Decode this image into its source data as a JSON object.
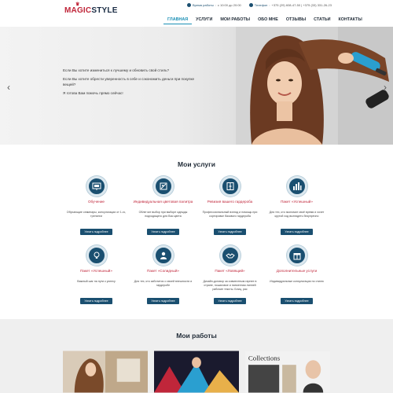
{
  "header": {
    "logo_magic": "MAGIC",
    "logo_style": "STYLE",
    "hours_label": "Время работы",
    "hours_value": "с 10:00 до 20:00",
    "phone_label": "Телефон",
    "phone_value": "+375 (29) 608-47-50 | +375 (33) 331-26-23",
    "nav": [
      {
        "label": "Главная",
        "active": true
      },
      {
        "label": "Услуги"
      },
      {
        "label": "Мои работы"
      },
      {
        "label": "Обо мне"
      },
      {
        "label": "Отзывы"
      },
      {
        "label": "Статьи"
      },
      {
        "label": "Контакты"
      }
    ]
  },
  "hero": {
    "lines": [
      "Если Вы хотите измениться к лучшему и обновить свой стиль?",
      "Если Вы хотите обрести уверенность в себе и сэкономить деньги при покупке вещей?",
      "Я готова Вам помочь прямо сейчас!"
    ],
    "prev": "‹",
    "next": "›"
  },
  "services": {
    "title": "Мои услуги",
    "button_label": "Узнать подробнее",
    "items": [
      {
        "title": "Обучение",
        "desc": "Обучающие семинары, консультации от 1-го, тренинги",
        "icon": "presentation-icon"
      },
      {
        "title": "Индивидуальная цветовая палитра",
        "desc": "Облегчит выбор при выборе одежды подходящего для Вас цвета",
        "icon": "palette-icon"
      },
      {
        "title": "Ревизия вашего гардероба",
        "desc": "Профессиональный взгляд и помощь при сортировке базового гардероба",
        "icon": "wardrobe-icon"
      },
      {
        "title": "Пакет «Успешный»",
        "desc": "Для тех, кто экономит своё время и хочет крутой ход выглядеть безупречно",
        "icon": "city-icon"
      },
      {
        "title": "Пакет «Успешный»",
        "desc": "Важный шаг на пути к успеху",
        "icon": "bulb-icon"
      },
      {
        "title": "Пакет «Солидный»",
        "desc": "Для тех, кто заботится о своей внешности и гардеробе",
        "icon": "businessman-icon"
      },
      {
        "title": "Пакет «Ловящий»",
        "desc": "Дизайн-договор за совместным гарнее в стране, пошаговое и напоенная линней рабочие тексты. Блиц, рас",
        "icon": "handshake-icon"
      },
      {
        "title": "Дополнительные услуги",
        "desc": "Индивидуальные консультации по стилю",
        "icon": "gift-icon"
      }
    ]
  },
  "works": {
    "title": "Мои работы",
    "magazine_text": "Collections"
  },
  "colors": {
    "accent": "#c0263a",
    "primary": "#1a4f70",
    "nav_active": "#1a8fb5"
  }
}
